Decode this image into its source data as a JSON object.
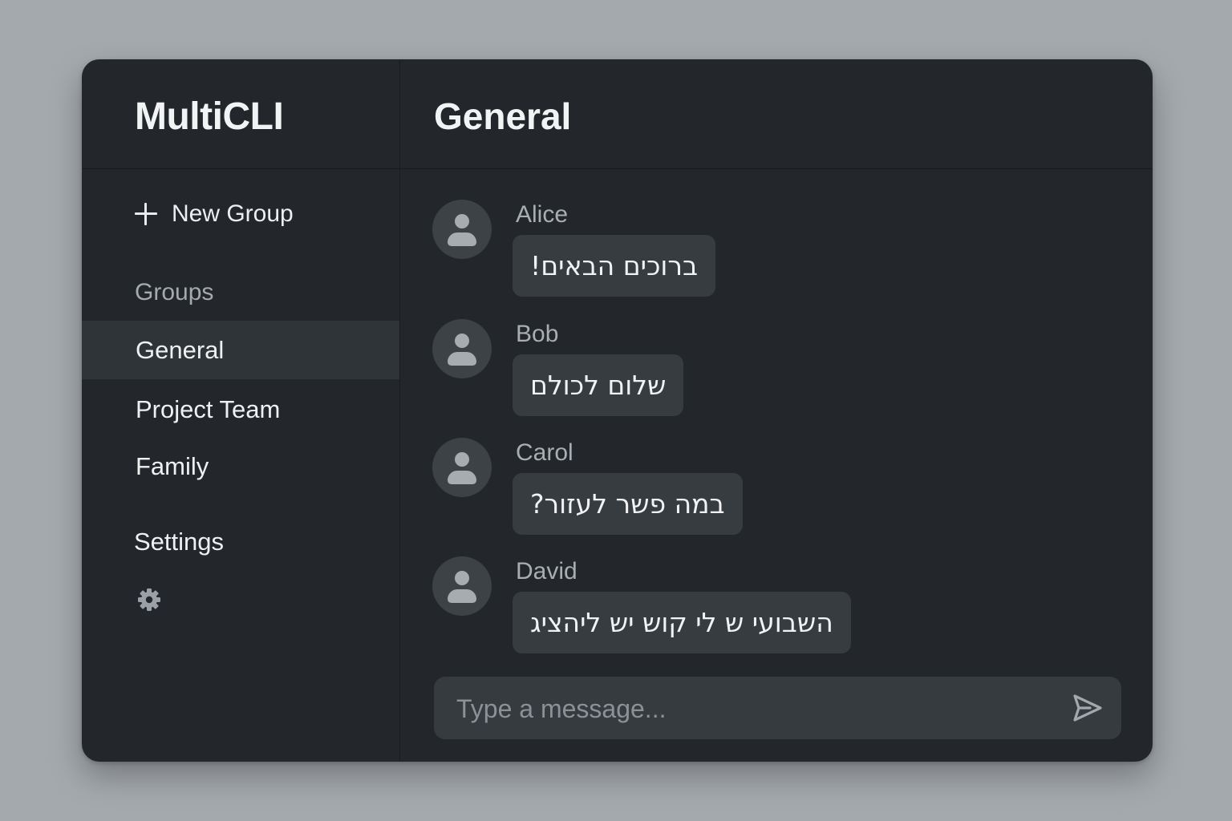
{
  "app": {
    "title": "MultiCLI"
  },
  "sidebar": {
    "new_group_label": "New Group",
    "groups_heading": "Groups",
    "groups": [
      {
        "label": "General",
        "active": true
      },
      {
        "label": "Project Team",
        "active": false
      },
      {
        "label": "Family",
        "active": false
      }
    ],
    "settings_label": "Settings",
    "settings_icon": "gear-icon"
  },
  "chat": {
    "title": "General",
    "messages": [
      {
        "sender": "Alice",
        "text": "ברוכים הבאים!",
        "avatar": "user-icon"
      },
      {
        "sender": "Bob",
        "text": "שלום לכולם",
        "avatar": "user-icon"
      },
      {
        "sender": "Carol",
        "text": "במה פשר לעזור?",
        "avatar": "user-icon"
      },
      {
        "sender": "David",
        "text": "השבועי ש לי קוש יש ליהציג",
        "avatar": "user-icon"
      }
    ],
    "composer": {
      "placeholder": "Type a message...",
      "value": "",
      "send_icon": "send-icon"
    }
  },
  "colors": {
    "background": "#a4a9ad",
    "window": "#23272b",
    "active_item": "#2f3438",
    "bubble": "#373c41",
    "avatar": "#3d4247"
  }
}
